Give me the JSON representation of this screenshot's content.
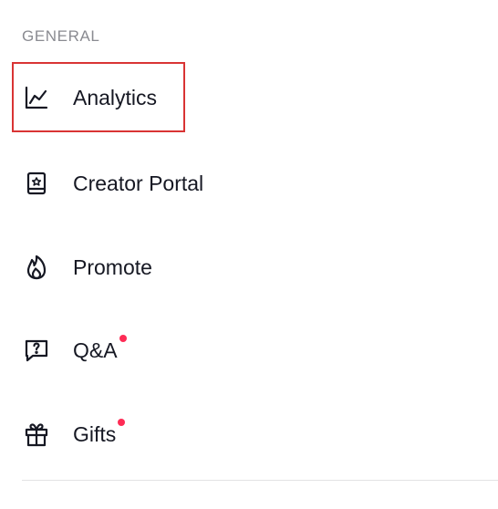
{
  "section": {
    "title": "GENERAL"
  },
  "items": [
    {
      "label": "Analytics",
      "icon": "analytics-icon",
      "badge": false,
      "highlighted": true
    },
    {
      "label": "Creator Portal",
      "icon": "creator-portal-icon",
      "badge": false,
      "highlighted": false
    },
    {
      "label": "Promote",
      "icon": "flame-icon",
      "badge": false,
      "highlighted": false
    },
    {
      "label": "Q&A",
      "icon": "question-chat-icon",
      "badge": true,
      "highlighted": false
    },
    {
      "label": "Gifts",
      "icon": "gift-icon",
      "badge": true,
      "highlighted": false
    }
  ],
  "colors": {
    "text": "#161823",
    "header": "#8a8b91",
    "badge": "#fe2c55",
    "highlight_border": "#d93434",
    "divider": "#e3e3e4"
  }
}
